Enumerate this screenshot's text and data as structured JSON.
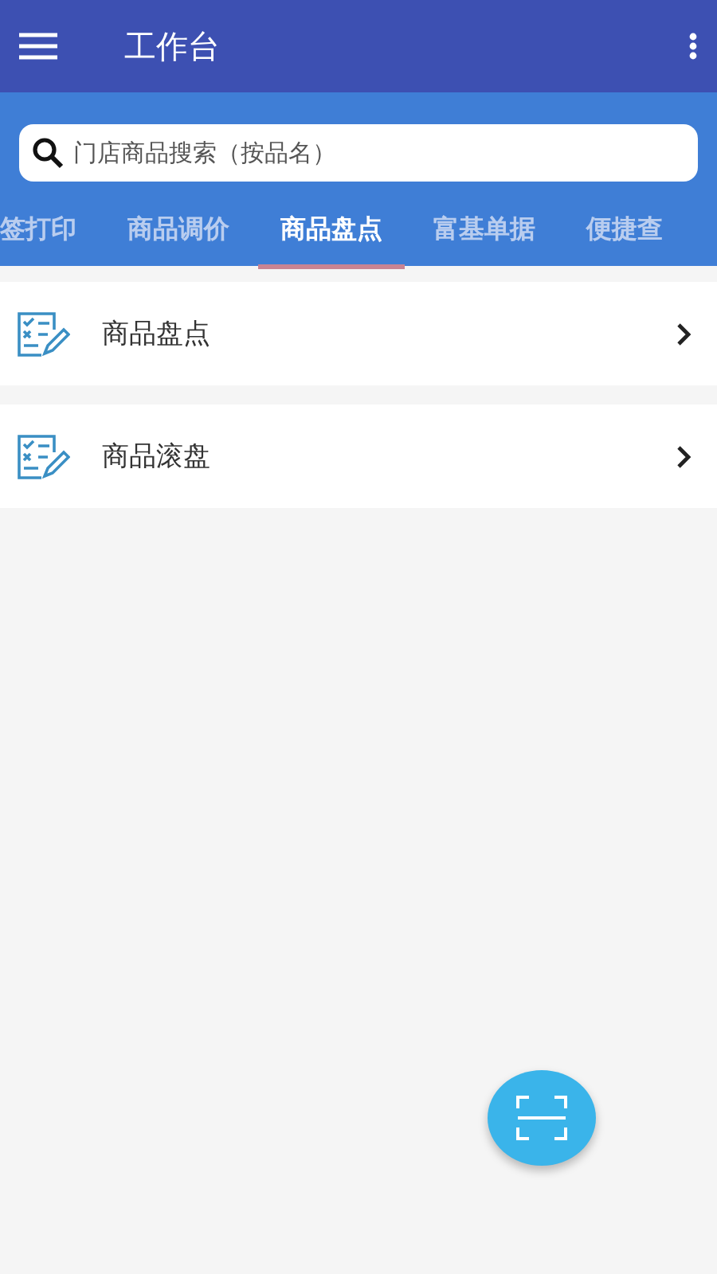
{
  "app_bar": {
    "title": "工作台"
  },
  "search": {
    "placeholder": "门店商品搜索（按品名）"
  },
  "tabs": [
    {
      "label": "签打印",
      "selected": false
    },
    {
      "label": "商品调价",
      "selected": false
    },
    {
      "label": "商品盘点",
      "selected": true
    },
    {
      "label": "富基单据",
      "selected": false
    },
    {
      "label": "便捷查",
      "selected": false
    }
  ],
  "items": [
    {
      "label": "商品盘点"
    },
    {
      "label": "商品滚盘"
    }
  ]
}
